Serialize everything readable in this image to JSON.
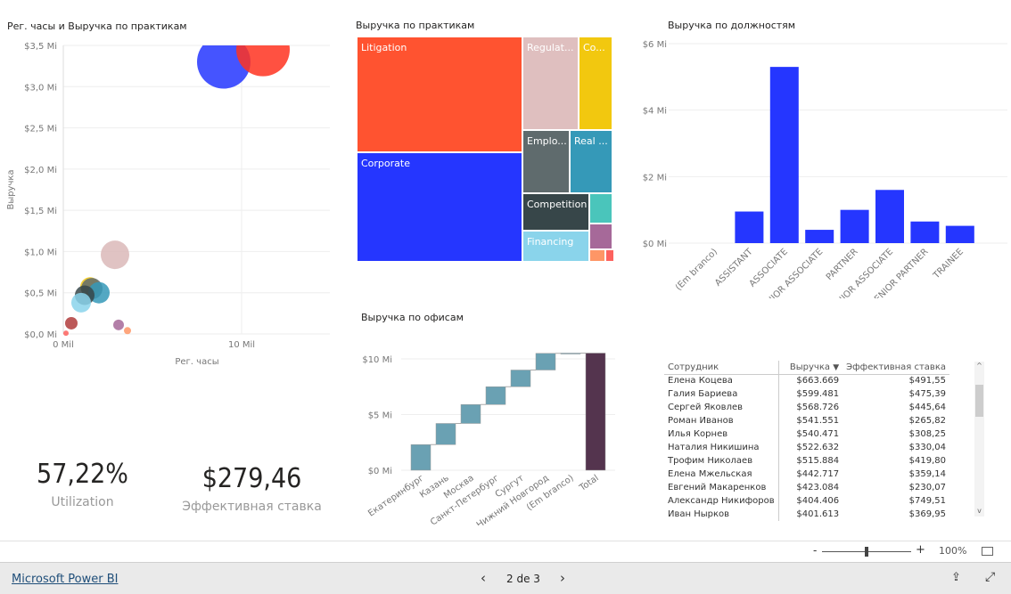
{
  "scatter": {
    "title": "Рег. часы и Выручка по практикам",
    "xlabel": "Рег. часы",
    "ylabel": "Выручка",
    "yticks": [
      "$0,0 Mi",
      "$0,5 Mi",
      "$1,0 Mi",
      "$1,5 Mi",
      "$2,0 Mi",
      "$2,5 Mi",
      "$3,0 Mi",
      "$3,5 Mi"
    ],
    "xticks": [
      "0 Mil",
      "10 Mil"
    ]
  },
  "treemap": {
    "title": "Выручка по практикам"
  },
  "bars": {
    "title": "Выручка по должностям",
    "yticks": [
      "$0 Mi",
      "$2 Mi",
      "$4 Mi",
      "$6 Mi"
    ]
  },
  "waterfall": {
    "title": "Выручка по офисам",
    "yticks": [
      "$0 Mi",
      "$5 Mi",
      "$10 Mi"
    ]
  },
  "kpi": {
    "utilization": {
      "value": "57,22%",
      "label": "Utilization"
    },
    "rate": {
      "value": "$279,46",
      "label": "Эффективная ставка"
    }
  },
  "table": {
    "headers": [
      "Сотрудник",
      "Выручка",
      "Эффективная ставка"
    ],
    "rows": [
      [
        "Елена Коцева",
        "$663.669",
        "$491,55"
      ],
      [
        "Галия Бариева",
        "$599.481",
        "$475,39"
      ],
      [
        "Сергей Яковлев",
        "$568.726",
        "$445,64"
      ],
      [
        "Роман Иванов",
        "$541.551",
        "$265,82"
      ],
      [
        "Илья Корнев",
        "$540.471",
        "$308,25"
      ],
      [
        "Наталия Никишина",
        "$522.632",
        "$330,04"
      ],
      [
        "Трофим Николаев",
        "$515.884",
        "$419,80"
      ],
      [
        "Елена Мжельская",
        "$442.717",
        "$359,14"
      ],
      [
        "Евгений Макаренков",
        "$423.084",
        "$230,07"
      ],
      [
        "Александр Никифоров",
        "$404.406",
        "$749,51"
      ],
      [
        "Иван Нырков",
        "$401.613",
        "$369,95"
      ]
    ]
  },
  "zoom": {
    "minus": "-",
    "plus": "+",
    "level": "100%",
    "slider_percent": 50
  },
  "footer": {
    "brand": "Microsoft Power BI",
    "page": "2 de 3"
  },
  "chart_data": [
    {
      "type": "scatter",
      "title": "Рег. часы и Выручка по практикам",
      "xlabel": "Рег. часы",
      "ylabel": "Выручка",
      "xlim": [
        0,
        15
      ],
      "ylim": [
        0,
        3.5
      ],
      "points": [
        {
          "x": 9.0,
          "y": 3.3,
          "size": 30,
          "color": "#2536ff"
        },
        {
          "x": 11.2,
          "y": 3.45,
          "size": 30,
          "color": "#ff3320"
        },
        {
          "x": 2.9,
          "y": 0.96,
          "size": 16,
          "color": "#dbb9b9"
        },
        {
          "x": 1.5,
          "y": 0.57,
          "size": 11,
          "color": "#f2c80f"
        },
        {
          "x": 1.6,
          "y": 0.55,
          "size": 12,
          "color": "#5f6b6d"
        },
        {
          "x": 2.0,
          "y": 0.5,
          "size": 12,
          "color": "#3599b8"
        },
        {
          "x": 1.2,
          "y": 0.47,
          "size": 11,
          "color": "#374649"
        },
        {
          "x": 1.0,
          "y": 0.38,
          "size": 11,
          "color": "#8ad4eb"
        },
        {
          "x": 0.45,
          "y": 0.13,
          "size": 7,
          "color": "#b03c3c"
        },
        {
          "x": 3.1,
          "y": 0.11,
          "size": 6,
          "color": "#a66999"
        },
        {
          "x": 3.6,
          "y": 0.04,
          "size": 4,
          "color": "#fe9666"
        },
        {
          "x": 0.15,
          "y": 0.01,
          "size": 3,
          "color": "#fd625e"
        }
      ]
    },
    {
      "type": "treemap",
      "title": "Выручка по практикам",
      "items": [
        {
          "label": "Litigation",
          "color": "#ff5330"
        },
        {
          "label": "Corporate",
          "color": "#2536ff"
        },
        {
          "label": "Regulat...",
          "color": "#dfbfbf"
        },
        {
          "label": "Co...",
          "color": "#f2c80f"
        },
        {
          "label": "Emplo...",
          "color": "#5f6b6d"
        },
        {
          "label": "Real ...",
          "color": "#3599b8"
        },
        {
          "label": "Competition",
          "color": "#374649"
        },
        {
          "label": "Financing",
          "color": "#8ad4eb"
        },
        {
          "label": "",
          "color": "#4ac5bb"
        },
        {
          "label": "",
          "color": "#a66999"
        },
        {
          "label": "",
          "color": "#fe9666"
        },
        {
          "label": "",
          "color": "#fd625e"
        }
      ]
    },
    {
      "type": "bar",
      "title": "Выручка по должностям",
      "ylim": [
        0,
        6
      ],
      "color": "#2536ff",
      "categories": [
        "(Em branco)",
        "ASSISTANT",
        "ASSOCIATE",
        "JUNIOR ASSOCIATE",
        "PARTNER",
        "SENIOR ASSOCIATE",
        "SENIOR PARTNER",
        "TRAINEE"
      ],
      "values": [
        0,
        0.95,
        5.3,
        0.4,
        1.0,
        1.6,
        0.65,
        0.52
      ]
    },
    {
      "type": "waterfall",
      "title": "Выручка по офисам",
      "ylim": [
        0,
        10.5
      ],
      "color": "#6aa1b3",
      "total_color": "#54344e",
      "categories": [
        "Екатеринбург",
        "Казань",
        "Москва",
        "Санкт-Петербург",
        "Сургут",
        "Нижний Новгород",
        "(Em branco)",
        "Total"
      ],
      "values": [
        2.3,
        1.9,
        1.7,
        1.6,
        1.5,
        1.5,
        0.02,
        10.52
      ]
    }
  ]
}
